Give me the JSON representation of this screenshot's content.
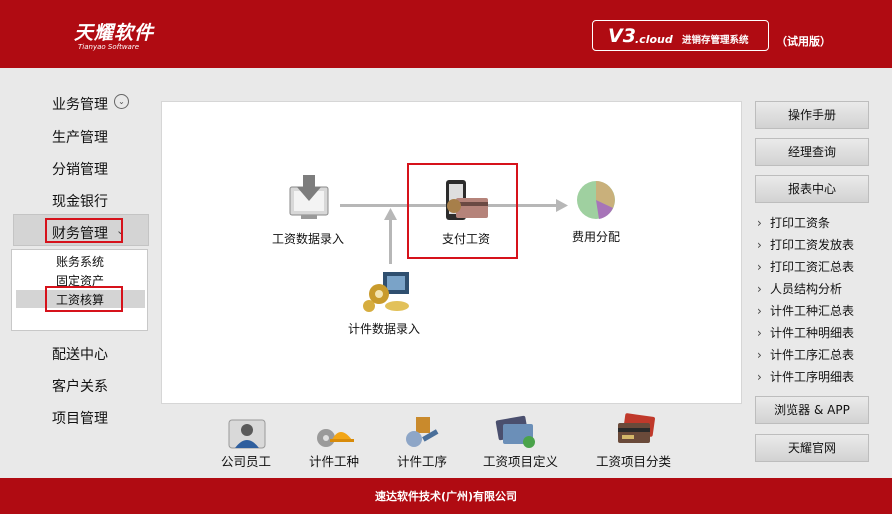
{
  "header": {
    "logo_cn": "天耀软件",
    "logo_en": "Tianyao Software",
    "version_main": "V3",
    "version_cloud": ".cloud",
    "system_name": "进销存管理系统",
    "edition": "（试用版）"
  },
  "left_menu": {
    "items": [
      "业务管理",
      "生产管理",
      "分销管理",
      "现金银行",
      "财务管理",
      "配送中心",
      "客户关系",
      "项目管理"
    ],
    "finance_submenu": [
      "账务系统",
      "固定资产",
      "工资核算"
    ]
  },
  "flow": {
    "salary_entry": "工资数据录入",
    "pay_salary": "支付工资",
    "expense_allocation": "费用分配",
    "piecework_entry": "计件数据录入"
  },
  "bottom_icons": [
    "公司员工",
    "计件工种",
    "计件工序",
    "工资项目定义",
    "工资项目分类"
  ],
  "right_panel": {
    "buttons": {
      "manual": "操作手册",
      "manager_query": "经理查询",
      "report_center": "报表中心",
      "browser_app": "浏览器 & APP",
      "official_site": "天耀官网"
    },
    "report_links": [
      "打印工资条",
      "打印工资发放表",
      "打印工资汇总表",
      "人员结构分析",
      "计件工种汇总表",
      "计件工种明细表",
      "计件工序汇总表",
      "计件工序明细表"
    ]
  },
  "footer": {
    "company": "速达软件技术(广州)有限公司"
  },
  "colors": {
    "brand_red": "#b00b12",
    "highlight_red": "#d6121b"
  }
}
